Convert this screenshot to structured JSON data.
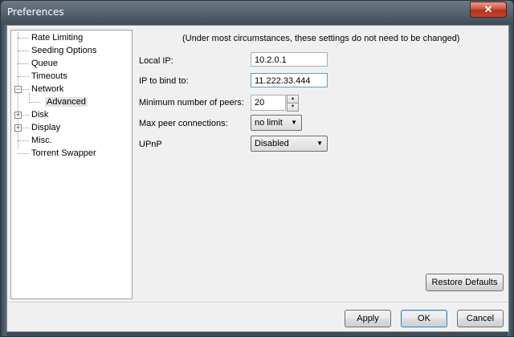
{
  "window": {
    "title": "Preferences",
    "close_glyph": "✕"
  },
  "tree": {
    "items": [
      {
        "label": "Rate Limiting"
      },
      {
        "label": "Seeding Options"
      },
      {
        "label": "Queue"
      },
      {
        "label": "Timeouts"
      },
      {
        "label": "Network"
      },
      {
        "label": "Advanced",
        "selected": true
      },
      {
        "label": "Disk"
      },
      {
        "label": "Display"
      },
      {
        "label": "Misc."
      },
      {
        "label": "Torrent Swapper"
      }
    ],
    "expand_glyph": "+",
    "collapse_glyph": "−"
  },
  "panel": {
    "note": "(Under most circumstances, these settings do not need to be changed)",
    "local_ip": {
      "label": "Local IP:",
      "value": "10.2.0.1"
    },
    "bind_ip": {
      "label": "IP to bind to:",
      "value": "11.222.33.444"
    },
    "min_peers": {
      "label": "Minimum number of peers:",
      "value": "20",
      "up_glyph": "▲",
      "down_glyph": "▼"
    },
    "max_peers": {
      "label": "Max peer connections:",
      "value": "no limit",
      "arrow": "▼"
    },
    "upnp": {
      "label": "UPnP",
      "value": "Disabled",
      "arrow": "▼"
    }
  },
  "buttons": {
    "restore": "Restore Defaults",
    "apply": "Apply",
    "ok": "OK",
    "cancel": "Cancel"
  }
}
